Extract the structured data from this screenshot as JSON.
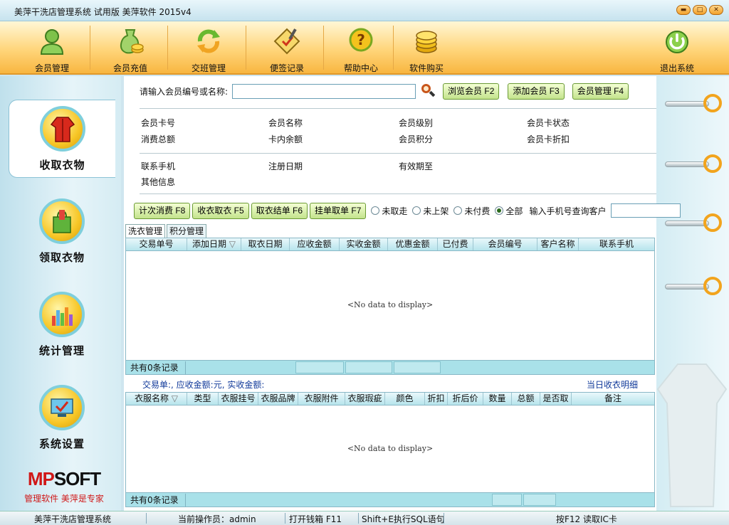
{
  "window": {
    "title": "美萍干洗店管理系统 试用版 美萍软件  2015v4",
    "buttons": {
      "minimize": "▬",
      "maximize": "□",
      "close": "✕"
    }
  },
  "toolbar": {
    "items": [
      {
        "label": "会员管理",
        "icon": "member-icon"
      },
      {
        "label": "会员充值",
        "icon": "recharge-icon"
      },
      {
        "label": "交班管理",
        "icon": "shift-icon"
      },
      {
        "label": "便签记录",
        "icon": "note-icon"
      },
      {
        "label": "帮助中心",
        "icon": "help-icon"
      },
      {
        "label": "软件购买",
        "icon": "purchase-icon"
      },
      {
        "label": "退出系统",
        "icon": "power-icon"
      }
    ]
  },
  "sidebar": {
    "items": [
      {
        "label": "收取衣物",
        "active": true
      },
      {
        "label": "领取衣物",
        "active": false
      },
      {
        "label": "统计管理",
        "active": false
      },
      {
        "label": "系统设置",
        "active": false
      }
    ],
    "logo": {
      "brand": "MPSOFT",
      "tagline": "管理软件  美萍是专家"
    }
  },
  "search": {
    "label": "请输入会员编号或名称:",
    "value": "",
    "buttons": [
      "浏览会员 F2",
      "添加会员 F3",
      "会员管理 F4"
    ]
  },
  "member_info": {
    "row1": [
      "会员卡号",
      "会员名称",
      "会员级别",
      "会员卡状态"
    ],
    "row2": [
      "消费总额",
      "卡内余额",
      "会员积分",
      "会员卡折扣"
    ],
    "row3": [
      "联系手机",
      "注册日期",
      "有效期至"
    ],
    "row4": [
      "其他信息"
    ]
  },
  "actions": {
    "buttons": [
      "计次消费 F8",
      "收衣取衣 F5",
      "取衣结单 F6",
      "挂单取单 F7"
    ],
    "radios": [
      {
        "label": "未取走",
        "checked": false
      },
      {
        "label": "未上架",
        "checked": false
      },
      {
        "label": "未付费",
        "checked": false
      },
      {
        "label": "全部",
        "checked": true
      }
    ],
    "phone_label": "输入手机号查询客户",
    "phone_value": ""
  },
  "tabs": [
    "洗衣管理",
    "积分管理"
  ],
  "orders_grid": {
    "columns": [
      "交易单号",
      "添加日期",
      "取衣日期",
      "应收金额",
      "实收金额",
      "优惠金额",
      "已付费",
      "会员编号",
      "客户名称",
      "联系手机"
    ],
    "sort_indicator": "▽",
    "empty_text": "<No data to display>",
    "footer_count": "共有0条记录"
  },
  "summary": {
    "text": "交易单:, 应收金额:元, 实收金额:",
    "link": "当日收衣明细"
  },
  "items_grid": {
    "columns": [
      "衣服名称",
      "类型",
      "衣服挂号",
      "衣服品牌",
      "衣服附件",
      "衣服瑕疵",
      "颜色",
      "折扣",
      "折后价",
      "数量",
      "总额",
      "是否取",
      "备注"
    ],
    "sort_indicator": "▽",
    "empty_text": "<No data to display>",
    "footer_count": "共有0条记录"
  },
  "statusbar": {
    "app": "美萍干洗店管理系统",
    "operator": "当前操作员：admin",
    "drawer": "打开钱箱 F11",
    "sql": "Shift+E执行SQL语句",
    "ic": "按F12 读取IC卡"
  },
  "colors": {
    "accent_orange": "#f8b640",
    "button_green": "#c3e38c",
    "panel_cyan": "#a9e1e9",
    "logo_red": "#d01818"
  }
}
